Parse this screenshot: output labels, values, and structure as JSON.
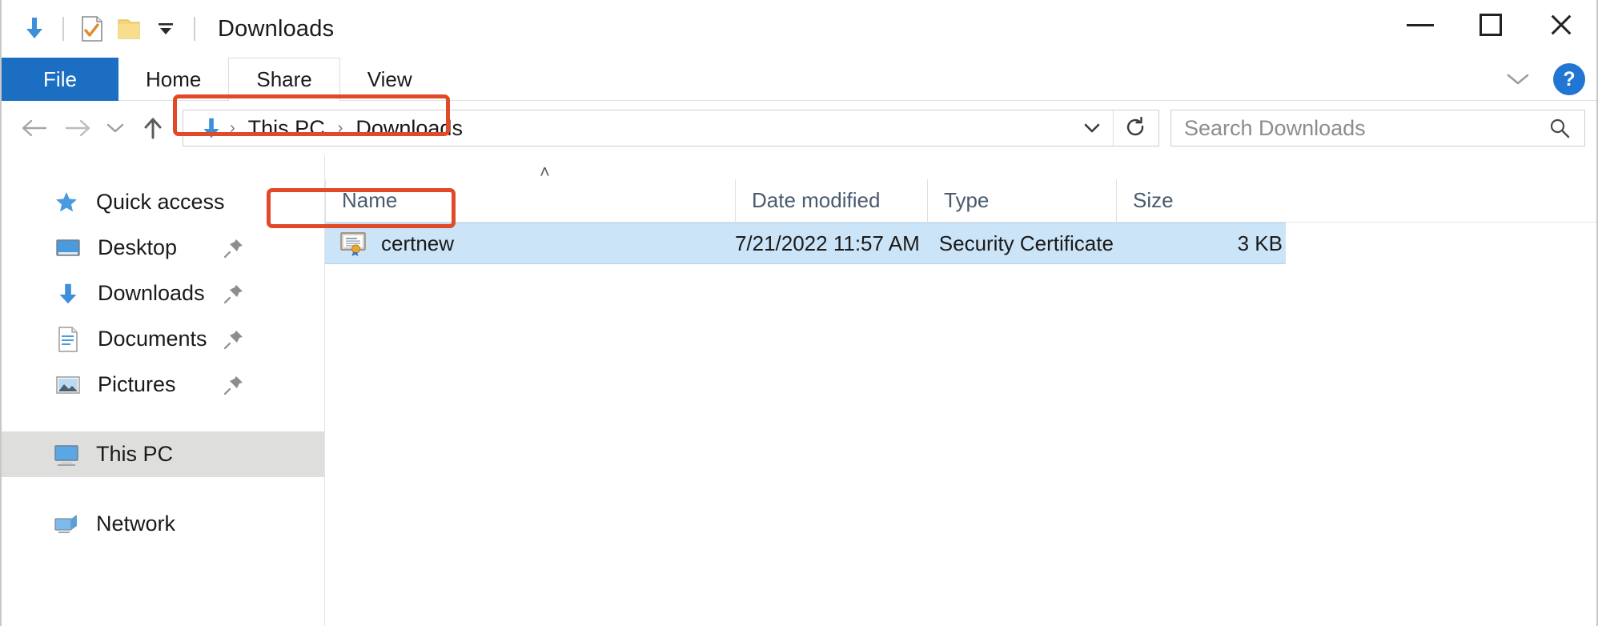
{
  "window": {
    "title": "Downloads",
    "quick_access_toolbar": [
      {
        "name": "downloads-folder-icon",
        "label": "Downloads"
      },
      {
        "name": "properties-icon",
        "label": "Properties"
      },
      {
        "name": "new-folder-icon",
        "label": "New folder"
      },
      {
        "name": "customize-quick-access-toolbar-icon",
        "label": "Customize Quick Access Toolbar"
      }
    ],
    "controls": {
      "minimize": "Minimize",
      "maximize": "Maximize",
      "close": "Close"
    }
  },
  "ribbon": {
    "tabs": [
      {
        "label": "File",
        "state": "active"
      },
      {
        "label": "Home",
        "state": "normal"
      },
      {
        "label": "Share",
        "state": "hovered"
      },
      {
        "label": "View",
        "state": "normal"
      }
    ],
    "collapse_label": "Minimize the Ribbon",
    "help_label": "?"
  },
  "address": {
    "back_label": "Back",
    "forward_label": "Forward",
    "recent_label": "Recent locations",
    "up_label": "Up",
    "breadcrumb": [
      {
        "label": "Downloads",
        "icon": "downloads-arrow-icon",
        "type": "icon"
      },
      {
        "label": "This PC",
        "type": "text"
      },
      {
        "label": "Downloads",
        "type": "text"
      }
    ],
    "separator": "›",
    "dropdown_label": "Previous locations",
    "refresh_label": "Refresh \"Downloads\" (F5)"
  },
  "search": {
    "placeholder": "Search Downloads",
    "icon": "search-icon"
  },
  "sidebar": {
    "items": [
      {
        "label": "Quick access",
        "icon": "star-icon",
        "level": "root",
        "pinned": false,
        "selected": false
      },
      {
        "label": "Desktop",
        "icon": "desktop-icon",
        "level": "child",
        "pinned": true,
        "selected": false
      },
      {
        "label": "Downloads",
        "icon": "downloads-icon",
        "level": "child",
        "pinned": true,
        "selected": false
      },
      {
        "label": "Documents",
        "icon": "documents-icon",
        "level": "child",
        "pinned": true,
        "selected": false
      },
      {
        "label": "Pictures",
        "icon": "pictures-icon",
        "level": "child",
        "pinned": true,
        "selected": false
      },
      {
        "label": "This PC",
        "icon": "this-pc-icon",
        "level": "root",
        "pinned": false,
        "selected": true
      },
      {
        "label": "Network",
        "icon": "network-icon",
        "level": "root",
        "pinned": false,
        "selected": false
      }
    ]
  },
  "file_list": {
    "columns": [
      {
        "label": "Name",
        "sorted": "asc"
      },
      {
        "label": "Date modified",
        "sorted": ""
      },
      {
        "label": "Type",
        "sorted": ""
      },
      {
        "label": "Size",
        "sorted": ""
      }
    ],
    "sort_indicator": "˄",
    "rows": [
      {
        "name": "certnew",
        "icon": "security-certificate-icon",
        "date_modified": "7/21/2022 11:57 AM",
        "type": "Security Certificate",
        "size": "3 KB",
        "selected": true
      }
    ]
  },
  "annotations": [
    {
      "name": "address-bar-highlight",
      "color": "#e04a28",
      "target": "breadcrumb"
    },
    {
      "name": "file-row-highlight",
      "color": "#e04a28",
      "target": "certnew file name"
    }
  ],
  "colors": {
    "accent": "#1b6ec2",
    "selection": "#cce4f7",
    "annotation": "#e04a28",
    "header_text": "#4a5b6e"
  }
}
